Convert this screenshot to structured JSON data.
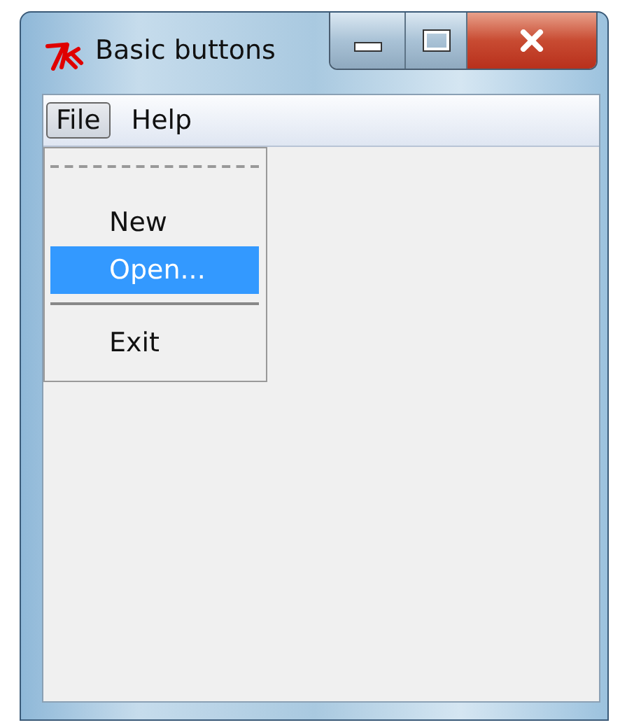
{
  "window": {
    "title": "Basic buttons"
  },
  "menu_bar": [
    {
      "label": "File",
      "selected": true
    },
    {
      "label": "Help",
      "selected": false
    }
  ],
  "dropdown": {
    "items": [
      {
        "kind": "tearoff"
      },
      {
        "kind": "command",
        "label": "New",
        "selected": false
      },
      {
        "kind": "command",
        "label": "Open...",
        "selected": true
      },
      {
        "kind": "separator"
      },
      {
        "kind": "command",
        "label": "Exit",
        "selected": false
      }
    ]
  }
}
